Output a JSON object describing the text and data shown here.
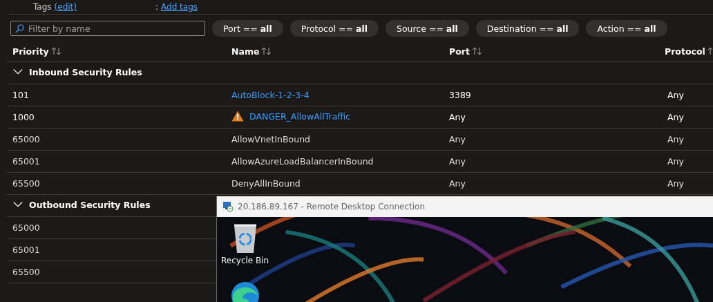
{
  "tags": {
    "label": "Tags",
    "edit_link": "(edit)",
    "separator": ":",
    "add_link": "Add tags"
  },
  "filter": {
    "placeholder": "Filter by name"
  },
  "filter_pills": [
    "Port == **all**",
    "Protocol == **all**",
    "Source == **all**",
    "Destination == **all**",
    "Action == **all**"
  ],
  "table": {
    "columns": [
      "Priority",
      "Name",
      "Port",
      "Protocol"
    ],
    "groups": [
      {
        "title": "Inbound Security Rules",
        "expanded": true,
        "rows": [
          {
            "priority": "101",
            "name": "AutoBlock-1-2-3-4",
            "link": true,
            "warning": false,
            "port": "3389",
            "protocol": "Any"
          },
          {
            "priority": "1000",
            "name": "DANGER_AllowAllTraffic",
            "link": true,
            "warning": true,
            "port": "Any",
            "protocol": "Any"
          },
          {
            "priority": "65000",
            "name": "AllowVnetInBound",
            "link": false,
            "warning": false,
            "port": "Any",
            "protocol": "Any"
          },
          {
            "priority": "65001",
            "name": "AllowAzureLoadBalancerInBound",
            "link": false,
            "warning": false,
            "port": "Any",
            "protocol": "Any"
          },
          {
            "priority": "65500",
            "name": "DenyAllInBound",
            "link": false,
            "warning": false,
            "port": "Any",
            "protocol": "Any"
          }
        ]
      },
      {
        "title": "Outbound Security Rules",
        "expanded": true,
        "rows": [
          {
            "priority": "65000",
            "link": false
          },
          {
            "priority": "65001",
            "link": false
          },
          {
            "priority": "65500",
            "link": false
          }
        ]
      }
    ]
  },
  "remote_window": {
    "title": "20.186.89.167 - Remote Desktop Connection",
    "desktop_icons": [
      {
        "kind": "recycle_bin",
        "label": "Recycle Bin"
      },
      {
        "kind": "browser"
      }
    ]
  }
}
